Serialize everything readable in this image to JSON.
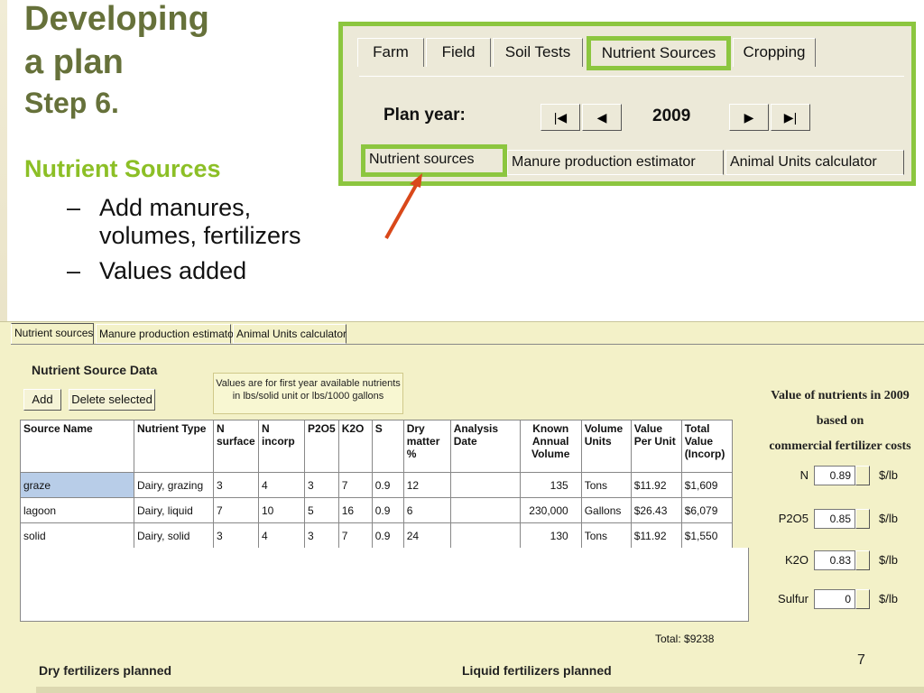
{
  "slide": {
    "title_line1": "Developing",
    "title_line2": "a plan",
    "step": "Step 6.",
    "subtitle": "Nutrient Sources",
    "bullet1_dash": "–",
    "bullet1": "Add manures, volumes, fertilizers",
    "bullet2_dash": "–",
    "bullet2": "Values added",
    "page_number": "7"
  },
  "inset": {
    "tabs": [
      "Farm",
      "Field",
      "Soil Tests",
      "Nutrient Sources",
      "Cropping"
    ],
    "plan_year_label": "Plan year:",
    "year": "2009",
    "nav": {
      "first": "|◀",
      "prev": "◀",
      "next": "▶",
      "last": "▶|"
    },
    "subtabs": [
      "Nutrient sources",
      "Manure production estimator",
      "Animal Units calculator"
    ]
  },
  "app": {
    "tabs": [
      "Nutrient sources",
      "Manure production estimator",
      "Animal Units calculator"
    ],
    "section_title": "Nutrient Source Data",
    "add_button": "Add",
    "delete_button": "Delete selected",
    "note_line1": "Values are for first year available nutrients",
    "note_line2": "in lbs/solid unit  or  lbs/1000 gallons",
    "columns": {
      "source_name": "Source Name",
      "nutrient_type": "Nutrient Type",
      "n_surface_1": "N",
      "n_surface_2": "surface",
      "n_incorp_1": "N",
      "n_incorp_2": "incorp",
      "p2o5": "P2O5",
      "k2o": "K2O",
      "s": "S",
      "dry_1": "Dry",
      "dry_2": "matter",
      "dry_3": "%",
      "analysis_1": "Analysis",
      "analysis_2": "Date",
      "known_1": "Known",
      "known_2": "Annual",
      "known_3": "Volume",
      "vunits_1": "Volume",
      "vunits_2": "Units",
      "value_1": "Value",
      "value_2": "Per Unit",
      "total_1": "Total",
      "total_2": "Value",
      "total_3": "(Incorp)"
    },
    "rows": [
      {
        "name": "graze",
        "type": "Dairy, grazing",
        "n_surface": "3",
        "n_incorp": "4",
        "p2o5": "3",
        "k2o": "7",
        "s": "0.9",
        "dry": "12",
        "analysis": "",
        "volume": "135",
        "units": "Tons",
        "value": "$11.92",
        "total": "$1,609"
      },
      {
        "name": "lagoon",
        "type": "Dairy, liquid",
        "n_surface": "7",
        "n_incorp": "10",
        "p2o5": "5",
        "k2o": "16",
        "s": "0.9",
        "dry": "6",
        "analysis": "",
        "volume": "230,000",
        "units": "Gallons",
        "value": "$26.43",
        "total": "$6,079"
      },
      {
        "name": "solid",
        "type": "Dairy, solid",
        "n_surface": "3",
        "n_incorp": "4",
        "p2o5": "3",
        "k2o": "7",
        "s": "0.9",
        "dry": "24",
        "analysis": "",
        "volume": "130",
        "units": "Tons",
        "value": "$11.92",
        "total": "$1,550"
      }
    ],
    "values_title_1": "Value of nutrients in 2009",
    "values_title_2": "based on",
    "values_title_3": "commercial fertilizer costs",
    "nutrient_values": [
      {
        "label": "N",
        "value": "0.89",
        "unit": "$/lb"
      },
      {
        "label": "P2O5",
        "value": "0.85",
        "unit": "$/lb"
      },
      {
        "label": "K2O",
        "value": "0.83",
        "unit": "$/lb"
      },
      {
        "label": "Sulfur",
        "value": "0",
        "unit": "$/lb"
      }
    ],
    "total_label": "Total:",
    "total_value": "$9238",
    "dry_fertilizers_title": "Dry fertilizers planned",
    "liquid_fertilizers_title": "Liquid fertilizers planned"
  },
  "colors": {
    "title_olive": "#66713a",
    "accent_green": "#8cc63f",
    "arrow_red": "#d9481a",
    "app_bg": "#f3f1c8",
    "selected_cell": "#b8cde8"
  }
}
